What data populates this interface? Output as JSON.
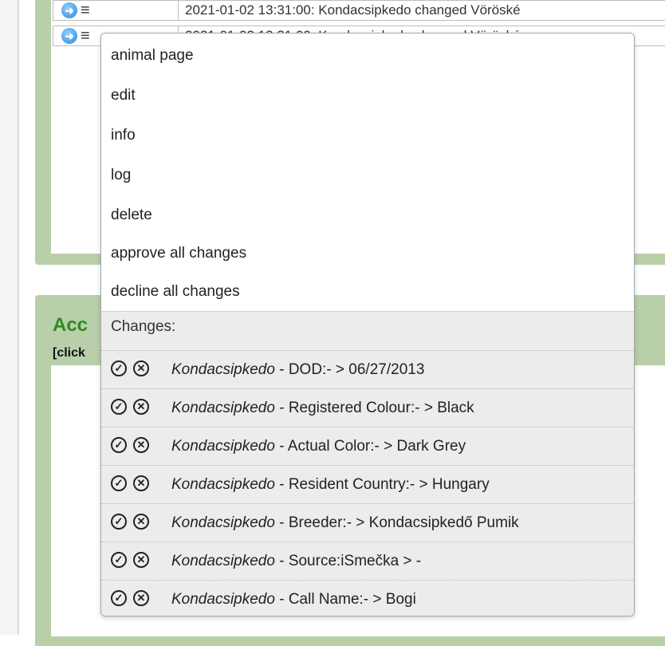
{
  "log_rows": [
    {
      "text": "2021-01-02 13:31:00: Kondacsipkedo changed Vöröské"
    },
    {
      "text": "2021-01-02 13:31:00: Kondacsipkedo changed Vöröské"
    }
  ],
  "lower_panel": {
    "title": "Acc",
    "subtitle": "[click"
  },
  "context_menu": {
    "items": [
      {
        "label": "animal page"
      },
      {
        "label": "edit"
      },
      {
        "label": "info"
      },
      {
        "label": "log"
      },
      {
        "label": "delete"
      },
      {
        "label": "approve all changes"
      },
      {
        "label": "decline all changes"
      }
    ],
    "changes_header": "Changes:",
    "changes": [
      {
        "name": "Kondacsipkedo",
        "detail": " - DOD:- > 06/27/2013"
      },
      {
        "name": "Kondacsipkedo",
        "detail": " - Registered Colour:- > Black"
      },
      {
        "name": "Kondacsipkedo",
        "detail": " - Actual Color:- > Dark Grey"
      },
      {
        "name": "Kondacsipkedo",
        "detail": " - Resident Country:- > Hungary"
      },
      {
        "name": "Kondacsipkedo",
        "detail": " - Breeder:- > Kondacsipkedő Pumik"
      },
      {
        "name": "Kondacsipkedo",
        "detail": " - Source:iSmečka > -"
      },
      {
        "name": "Kondacsipkedo",
        "detail": " - Call Name:- > Bogi"
      }
    ]
  },
  "icons": {
    "approve": "check-circle-icon",
    "decline": "x-circle-icon",
    "go": "arrow-right-circle-icon",
    "menu": "hamburger-icon"
  },
  "colors": {
    "panel_green": "#b9cfa9",
    "title_green": "#2e8b1f",
    "menu_changes_bg": "#ececec"
  }
}
